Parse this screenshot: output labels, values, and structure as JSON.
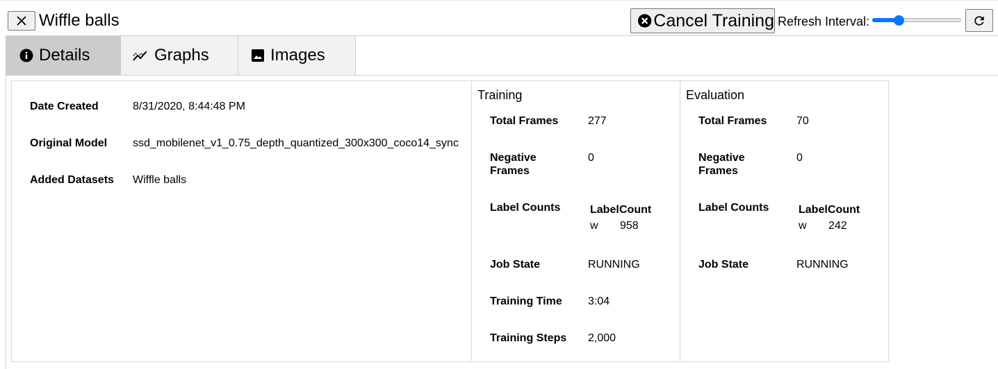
{
  "header": {
    "title": "Wiffle balls",
    "cancel_label": "Cancel Training",
    "refresh_interval_label": "Refresh Interval:",
    "refresh_slider_fraction": 0.3
  },
  "tabs": [
    {
      "label": "Details",
      "icon": "info-icon",
      "active": true
    },
    {
      "label": "Graphs",
      "icon": "line-chart-icon",
      "active": false
    },
    {
      "label": "Images",
      "icon": "image-icon",
      "active": false
    }
  ],
  "details": {
    "date_created_label": "Date Created",
    "date_created_value": "8/31/2020, 8:44:48 PM",
    "original_model_label": "Original Model",
    "original_model_value": "ssd_mobilenet_v1_0.75_depth_quantized_300x300_coco14_sync",
    "added_datasets_label": "Added Datasets",
    "added_datasets_value": "Wiffle balls"
  },
  "training": {
    "title": "Training",
    "total_frames_label": "Total Frames",
    "total_frames_value": "277",
    "negative_frames_label": "Negative Frames",
    "negative_frames_value": "0",
    "label_counts_label": "Label Counts",
    "label_col_header": "Label",
    "count_col_header": "Count",
    "label_rows": [
      {
        "label": "w",
        "count": "958"
      }
    ],
    "job_state_label": "Job State",
    "job_state_value": "RUNNING",
    "training_time_label": "Training Time",
    "training_time_value": "3:04",
    "training_steps_label": "Training Steps",
    "training_steps_value": "2,000"
  },
  "evaluation": {
    "title": "Evaluation",
    "total_frames_label": "Total Frames",
    "total_frames_value": "70",
    "negative_frames_label": "Negative Frames",
    "negative_frames_value": "0",
    "label_counts_label": "Label Counts",
    "label_col_header": "Label",
    "count_col_header": "Count",
    "label_rows": [
      {
        "label": "w",
        "count": "242"
      }
    ],
    "job_state_label": "Job State",
    "job_state_value": "RUNNING"
  },
  "colors": {
    "accent": "#0a75ff",
    "active_tab": "#cccccc",
    "tab_bg": "#f2f2f2"
  }
}
